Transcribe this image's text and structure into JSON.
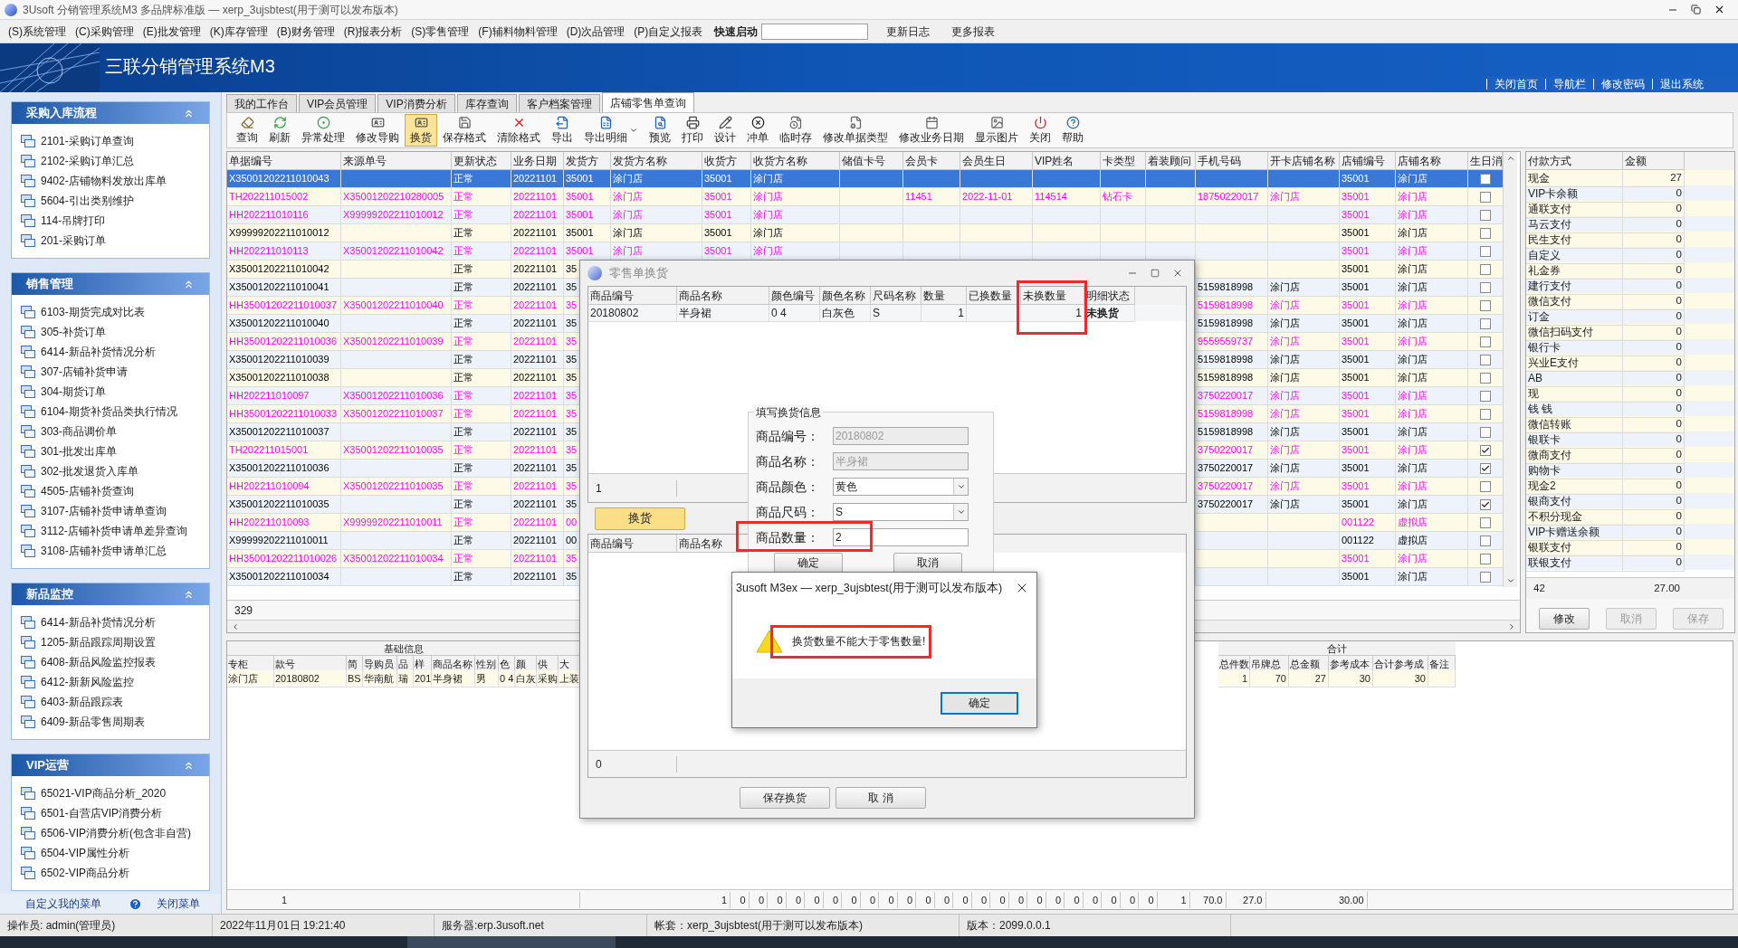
{
  "window": {
    "title": "3Usoft 分销管理系统M3 多品牌标准版 — xerp_3ujsbtest(用于测可以发布版本)"
  },
  "menu": [
    "(S)系统管理",
    "(C)采购管理",
    "(E)批发管理",
    "(K)库存管理",
    "(B)财务管理",
    "(R)报表分析",
    "(S)零售管理",
    "(F)辅料物料管理",
    "(D)次品管理",
    "(P)自定义报表"
  ],
  "quick_launch": {
    "label": "快速启动"
  },
  "menu_links": [
    "更新日志",
    "更多报表"
  ],
  "banner": {
    "title": "三联分销管理系统M3",
    "links": [
      "关闭首页",
      "导航栏",
      "修改密码",
      "退出系统"
    ]
  },
  "sidebar": {
    "groups": [
      {
        "title": "采购入库流程",
        "expanded": true,
        "items": [
          "2101-采购订单查询",
          "2102-采购订单汇总",
          "9402-店铺物料发放出库单",
          "5604-引出类别维护",
          "114-吊牌打印",
          "201-采购订单"
        ]
      },
      {
        "title": "销售管理",
        "expanded": true,
        "items": [
          "6103-期货完成对比表",
          "305-补货订单",
          "6414-新品补货情况分析",
          "307-店铺补货申请",
          "304-期货订单",
          "6104-期货补货品类执行情况",
          "303-商品调价单",
          "301-批发出库单",
          "302-批发退货入库单",
          "4505-店铺补货查询",
          "3107-店铺补货申请单查询",
          "3112-店铺补货申请单差异查询",
          "3108-店铺补货申请单汇总"
        ]
      },
      {
        "title": "新品监控",
        "expanded": true,
        "items": [
          "6414-新品补货情况分析",
          "1205-新品跟踪周期设置",
          "6408-新品风险监控报表",
          "6412-新新风险监控",
          "6403-新品跟踪表",
          "6409-新品零售周期表"
        ]
      },
      {
        "title": "VIP运营",
        "expanded": true,
        "items": [
          "65021-VIP商品分析_2020",
          "6501-自营店VIP消费分析",
          "6506-VIP消费分析(包含非自营)",
          "6504-VIP属性分析",
          "6502-VIP商品分析"
        ]
      }
    ],
    "footer_links": [
      "自定义我的菜单",
      "关闭菜单"
    ]
  },
  "tabs": [
    {
      "label": "我的工作台",
      "selected": false
    },
    {
      "label": "VIP会员管理",
      "selected": false
    },
    {
      "label": "VIP消费分析",
      "selected": false
    },
    {
      "label": "库存查询",
      "selected": false
    },
    {
      "label": "客户档案管理",
      "selected": false
    },
    {
      "label": "店铺零售单查询",
      "selected": true
    }
  ],
  "toolbar": [
    {
      "label": "查询",
      "selected": false,
      "dropdown": false
    },
    {
      "label": "刷新",
      "selected": false,
      "dropdown": false
    },
    {
      "label": "异常处理",
      "selected": false,
      "dropdown": false
    },
    {
      "label": "修改导购",
      "selected": false,
      "dropdown": false
    },
    {
      "label": "换货",
      "selected": true,
      "dropdown": false
    },
    {
      "label": "保存格式",
      "selected": false,
      "dropdown": false
    },
    {
      "label": "清除格式",
      "selected": false,
      "dropdown": false
    },
    {
      "label": "导出",
      "selected": false,
      "dropdown": false
    },
    {
      "label": "导出明细",
      "selected": false,
      "dropdown": true
    },
    {
      "label": "预览",
      "selected": false,
      "dropdown": false
    },
    {
      "label": "打印",
      "selected": false,
      "dropdown": false
    },
    {
      "label": "设计",
      "selected": false,
      "dropdown": false
    },
    {
      "label": "冲单",
      "selected": false,
      "dropdown": false
    },
    {
      "label": "临时存",
      "selected": false,
      "dropdown": false
    },
    {
      "label": "修改单据类型",
      "selected": false,
      "dropdown": false
    },
    {
      "label": "修改业务日期",
      "selected": false,
      "dropdown": false
    },
    {
      "label": "显示图片",
      "selected": false,
      "dropdown": false
    },
    {
      "label": "关闭",
      "selected": false,
      "dropdown": false
    },
    {
      "label": "帮助",
      "selected": false,
      "dropdown": false
    }
  ],
  "table": {
    "columns": [
      "单据编号",
      "来源单号",
      "更新状态",
      "业务日期",
      "发货方",
      "发货方名称",
      "收货方",
      "收货方名称",
      "储值卡号",
      "会员卡",
      "会员生日",
      "VIP姓名",
      "卡类型",
      "着装顾问",
      "手机号码",
      "开卡店铺名称",
      "店铺编号",
      "店铺名称",
      "生日消"
    ],
    "rows": [
      {
        "doc_no": "X35001202211010043",
        "status": "正常",
        "date": "20221101",
        "sender": "35001",
        "sender_name": "涂门店",
        "receiver": "35001",
        "receiver_name": "涂门店",
        "store_no": "35001",
        "store_name": "涂门店",
        "checked": false,
        "selected": true
      },
      {
        "doc_no": "TH202211015002",
        "source_no": "X35001202210280005",
        "status": "正常",
        "date": "20221101",
        "sender": "35001",
        "sender_name": "涂门店",
        "receiver": "35001",
        "receiver_name": "涂门店",
        "member_card": "11451",
        "member_birthday": "2022-11-01",
        "vip_name": "114514",
        "card_type": "钻石卡",
        "phone": "18750220017",
        "card_store": "涂门店",
        "store_no": "35001",
        "store_name": "涂门店",
        "checked": false,
        "color": "#ff00ff",
        "selected": false
      },
      {
        "doc_no": "HH202211010116",
        "source_no": "X99999202211010012",
        "status": "正常",
        "date": "20221101",
        "sender": "35001",
        "sender_name": "涂门店",
        "receiver": "35001",
        "receiver_name": "涂门店",
        "store_no": "35001",
        "store_name": "涂门店",
        "checked": false,
        "color": "#ff00ff",
        "selected": false
      },
      {
        "doc_no": "X99999202211010012",
        "status": "正常",
        "date": "20221101",
        "sender": "35001",
        "sender_name": "涂门店",
        "receiver": "35001",
        "receiver_name": "涂门店",
        "store_no": "35001",
        "store_name": "涂门店",
        "checked": false,
        "color": "#000000",
        "selected": false
      },
      {
        "doc_no": "HH202211010113",
        "source_no": "X35001202211010042",
        "status": "正常",
        "date": "20221101",
        "sender": "35001",
        "sender_name": "涂门店",
        "receiver": "35001",
        "receiver_name": "涂门店",
        "store_no": "35001",
        "store_name": "涂门店",
        "checked": false,
        "color": "#ff00ff",
        "selected": false
      },
      {
        "doc_no": "X35001202211010042",
        "status": "正常",
        "date": "20221101",
        "sender": "35",
        "store_no": "35001",
        "store_name": "涂门店",
        "checked": false,
        "color": "#000000",
        "selected": false
      },
      {
        "doc_no": "X35001202211010041",
        "status": "正常",
        "date": "20221101",
        "sender": "35",
        "phone": "5159818998",
        "card_store": "涂门店",
        "store_no": "35001",
        "store_name": "涂门店",
        "checked": false,
        "color": "#000000",
        "selected": false
      },
      {
        "doc_no": "HH35001202211010037",
        "source_no": "X35001202211010040",
        "status": "正常",
        "date": "20221101",
        "sender": "35",
        "phone": "5159818998",
        "card_store": "涂门店",
        "store_no": "35001",
        "store_name": "涂门店",
        "checked": false,
        "color": "#ff00ff",
        "selected": false
      },
      {
        "doc_no": "X35001202211010040",
        "status": "正常",
        "date": "20221101",
        "sender": "35",
        "phone": "5159818998",
        "card_store": "涂门店",
        "store_no": "35001",
        "store_name": "涂门店",
        "checked": false,
        "color": "#000000",
        "selected": false
      },
      {
        "doc_no": "HH35001202211010036",
        "source_no": "X35001202211010039",
        "status": "正常",
        "date": "20221101",
        "sender": "35",
        "phone": "9559559737",
        "card_store": "涂门店",
        "store_no": "35001",
        "store_name": "涂门店",
        "checked": false,
        "color": "#ff00ff",
        "selected": false
      },
      {
        "doc_no": "X35001202211010039",
        "status": "正常",
        "date": "20221101",
        "sender": "35",
        "phone": "5159818998",
        "card_store": "涂门店",
        "store_no": "35001",
        "store_name": "涂门店",
        "checked": false,
        "color": "#000000",
        "selected": false
      },
      {
        "doc_no": "X35001202211010038",
        "status": "正常",
        "date": "20221101",
        "sender": "35",
        "phone": "5159818998",
        "card_store": "涂门店",
        "store_no": "35001",
        "store_name": "涂门店",
        "checked": false,
        "color": "#000000",
        "selected": false
      },
      {
        "doc_no": "HH202211010097",
        "source_no": "X35001202211010036",
        "status": "正常",
        "date": "20221101",
        "sender": "35",
        "phone": "3750220017",
        "card_store": "涂门店",
        "store_no": "35001",
        "store_name": "涂门店",
        "checked": false,
        "color": "#ff00ff",
        "selected": false
      },
      {
        "doc_no": "HH35001202211010033",
        "source_no": "X35001202211010037",
        "status": "正常",
        "date": "20221101",
        "sender": "35",
        "phone": "5159818998",
        "card_store": "涂门店",
        "store_no": "35001",
        "store_name": "涂门店",
        "checked": false,
        "color": "#ff00ff",
        "selected": false
      },
      {
        "doc_no": "X35001202211010037",
        "status": "正常",
        "date": "20221101",
        "sender": "35",
        "phone": "5159818998",
        "card_store": "涂门店",
        "store_no": "35001",
        "store_name": "涂门店",
        "checked": false,
        "color": "#000000",
        "selected": false
      },
      {
        "doc_no": "TH202211015001",
        "source_no": "X35001202211010035",
        "status": "正常",
        "date": "20221101",
        "sender": "35",
        "phone": "3750220017",
        "card_store": "涂门店",
        "store_no": "35001",
        "store_name": "涂门店",
        "checked": true,
        "color": "#ff00ff",
        "selected": false
      },
      {
        "doc_no": "X35001202211010036",
        "status": "正常",
        "date": "20221101",
        "sender": "35",
        "phone": "3750220017",
        "card_store": "涂门店",
        "store_no": "35001",
        "store_name": "涂门店",
        "checked": true,
        "color": "#000000",
        "selected": false
      },
      {
        "doc_no": "HH202211010094",
        "source_no": "X35001202211010035",
        "status": "正常",
        "date": "20221101",
        "sender": "35",
        "phone": "3750220017",
        "card_store": "涂门店",
        "store_no": "35001",
        "store_name": "涂门店",
        "checked": false,
        "color": "#ff00ff",
        "selected": false
      },
      {
        "doc_no": "X35001202211010035",
        "status": "正常",
        "date": "20221101",
        "sender": "35",
        "phone": "3750220017",
        "card_store": "涂门店",
        "store_no": "35001",
        "store_name": "涂门店",
        "checked": true,
        "color": "#000000",
        "selected": false
      },
      {
        "doc_no": "HH202211010093",
        "source_no": "X99999202211010011",
        "status": "正常",
        "date": "20221101",
        "sender": "00",
        "store_no": "001122",
        "store_name": "虚拟店",
        "checked": false,
        "color": "#ff00ff",
        "selected": false
      },
      {
        "doc_no": "X99999202211010011",
        "status": "正常",
        "date": "20221101",
        "sender": "00",
        "store_no": "001122",
        "store_name": "虚拟店",
        "checked": false,
        "color": "#000000",
        "selected": false
      },
      {
        "doc_no": "HH35001202211010026",
        "source_no": "X35001202211010034",
        "status": "正常",
        "date": "20221101",
        "sender": "35",
        "store_no": "35001",
        "store_name": "涂门店",
        "checked": false,
        "color": "#ff00ff",
        "selected": false
      },
      {
        "doc_no": "X35001202211010034",
        "status": "正常",
        "date": "20221101",
        "sender": "35",
        "store_no": "35001",
        "store_name": "涂门店",
        "checked": false,
        "color": "#000000",
        "selected": false
      }
    ],
    "footer": "329"
  },
  "payments": {
    "columns": [
      "付款方式",
      "金额"
    ],
    "rows": [
      {
        "method": "现金",
        "amount": "27"
      },
      {
        "method": "VIP卡余额",
        "amount": "0"
      },
      {
        "method": "通联支付",
        "amount": "0"
      },
      {
        "method": "马云支付",
        "amount": "0"
      },
      {
        "method": "民生支付",
        "amount": "0"
      },
      {
        "method": "自定义",
        "amount": "0"
      },
      {
        "method": "礼金券",
        "amount": "0"
      },
      {
        "method": "建行支付",
        "amount": "0"
      },
      {
        "method": "微信支付",
        "amount": "0"
      },
      {
        "method": "订金",
        "amount": "0"
      },
      {
        "method": "微信扫码支付",
        "amount": "0"
      },
      {
        "method": "银行卡",
        "amount": "0"
      },
      {
        "method": "兴业E支付",
        "amount": "0"
      },
      {
        "method": "AB",
        "amount": "0"
      },
      {
        "method": "现",
        "amount": "0"
      },
      {
        "method": "钱 钱",
        "amount": "0"
      },
      {
        "method": "微信转账",
        "amount": "0"
      },
      {
        "method": "银联卡",
        "amount": "0"
      },
      {
        "method": "微商支付",
        "amount": "0"
      },
      {
        "method": "购物卡",
        "amount": "0"
      },
      {
        "method": "现金2",
        "amount": "0"
      },
      {
        "method": "银商支付",
        "amount": "0"
      },
      {
        "method": "不积分现金",
        "amount": "0"
      },
      {
        "method": "VIP卡赠送余额",
        "amount": "0"
      },
      {
        "method": "银联支付",
        "amount": "0"
      },
      {
        "method": "联银支付",
        "amount": "0"
      }
    ],
    "footer": {
      "count": "42",
      "total": "27.00"
    },
    "buttons": [
      {
        "label": "修改",
        "disabled": false
      },
      {
        "label": "取消",
        "disabled": true
      },
      {
        "label": "保存",
        "disabled": true
      }
    ]
  },
  "detail_table": {
    "groups": [
      "基础信息",
      "合计"
    ],
    "left_columns": [
      "专柜",
      "款号",
      "简",
      "导购员",
      "品",
      "样",
      "商品名称",
      "性别",
      "色",
      "颜",
      "供",
      "大"
    ],
    "left_values": [
      "涂门店",
      "20180802",
      "BS",
      "华南航",
      "瑞",
      "201",
      "半身裙",
      "男",
      "0 4",
      "白灰",
      "采购",
      "上装"
    ],
    "right_columns": [
      "总件数",
      "吊牌总",
      "总金额",
      "参考成本",
      "合计参考成",
      "备注"
    ],
    "right_values": [
      "1",
      "70",
      "27",
      "30",
      "30"
    ],
    "summary": {
      "count": "1",
      "totals": [
        "1",
        "0",
        "0",
        "0",
        "0",
        "0",
        "0",
        "0",
        "0",
        "0",
        "0",
        "0",
        "0",
        "0",
        "0",
        "0",
        "0",
        "0",
        "0",
        "0",
        "0",
        "0",
        "0",
        "0",
        "1",
        "70.0",
        "27.0",
        "30.00"
      ]
    }
  },
  "exchange_dialog": {
    "title": "零售单换货",
    "columns": [
      "商品编号",
      "商品名称",
      "颜色编号",
      "颜色名称",
      "尺码名称",
      "数量",
      "已换数量",
      "未换数量",
      "明细状态"
    ],
    "rows": [
      {
        "code": "20180802",
        "name": "半身裙",
        "color_code": "0 4",
        "color_name": "白灰色",
        "size": "S",
        "qty": "1",
        "remaining": "1",
        "status": "未换货"
      }
    ],
    "count": "1",
    "exchange_button": "换货",
    "lower_columns": [
      "商品编号",
      "商品名称"
    ],
    "lower_count": "0",
    "form": {
      "legend": "填写换货信息",
      "fields": [
        {
          "label": "商品编号：",
          "value": "20180802",
          "kind": "text",
          "disabled": true
        },
        {
          "label": "商品名称：",
          "value": "半身裙",
          "kind": "text",
          "disabled": true
        },
        {
          "label": "商品颜色：",
          "value": "黄色",
          "kind": "select",
          "disabled": false
        },
        {
          "label": "商品尺码：",
          "value": "S",
          "kind": "select",
          "disabled": false
        },
        {
          "label": "商品数量：",
          "value": "2",
          "kind": "text",
          "disabled": false
        }
      ],
      "buttons": [
        "确定",
        "取消"
      ]
    },
    "buttons": [
      "保存换货",
      "取 消"
    ]
  },
  "alert": {
    "title": "3usoft M3ex — xerp_3ujsbtest(用于测可以发布版本)",
    "message": "换货数量不能大于零售数量!",
    "button": "确定"
  },
  "status_bar": [
    "操作员: admin(管理员)",
    "2022年11月01日 19:21:40",
    "服务器:erp.3usoft.net",
    "帐套：xerp_3ujsbtest(用于测可以发布版本)",
    "版本：2099.0.0.1"
  ]
}
